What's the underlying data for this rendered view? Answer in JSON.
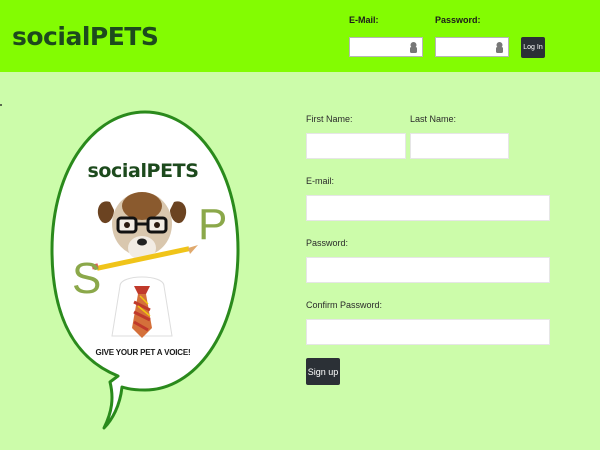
{
  "header": {
    "brand": "socialPETS",
    "email_label": "E-Mail:",
    "password_label": "Password:",
    "email_value": "",
    "password_value": "",
    "login_label": "Log In"
  },
  "logo": {
    "title": "socialPETS",
    "letter_s": "S",
    "letter_p": "P",
    "tagline": "GIVE YOUR PET A VOICE!"
  },
  "signup": {
    "first_name_label": "First Name:",
    "last_name_label": "Last Name:",
    "email_label": "E-mail:",
    "password_label": "Password:",
    "confirm_password_label": "Confirm Password:",
    "first_name_value": "",
    "last_name_value": "",
    "email_value": "",
    "password_value": "",
    "confirm_password_value": "",
    "signup_label": "Sign up"
  },
  "colors": {
    "header_bg": "#83fc02",
    "page_bg": "#ccfcaa",
    "brand_text": "#1d4a1d",
    "button_bg": "#2b3036",
    "bubble_border": "#2a8a1c"
  }
}
